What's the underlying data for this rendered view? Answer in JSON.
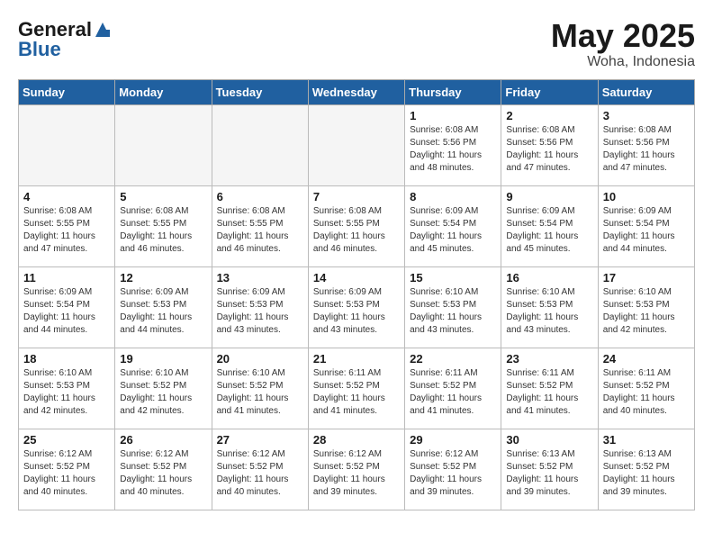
{
  "header": {
    "logo_text_general": "General",
    "logo_text_blue": "Blue",
    "title": "May 2025",
    "subtitle": "Woha, Indonesia"
  },
  "calendar": {
    "days_of_week": [
      "Sunday",
      "Monday",
      "Tuesday",
      "Wednesday",
      "Thursday",
      "Friday",
      "Saturday"
    ],
    "weeks": [
      [
        {
          "day": "",
          "info": ""
        },
        {
          "day": "",
          "info": ""
        },
        {
          "day": "",
          "info": ""
        },
        {
          "day": "",
          "info": ""
        },
        {
          "day": "1",
          "info": "Sunrise: 6:08 AM\nSunset: 5:56 PM\nDaylight: 11 hours\nand 48 minutes."
        },
        {
          "day": "2",
          "info": "Sunrise: 6:08 AM\nSunset: 5:56 PM\nDaylight: 11 hours\nand 47 minutes."
        },
        {
          "day": "3",
          "info": "Sunrise: 6:08 AM\nSunset: 5:56 PM\nDaylight: 11 hours\nand 47 minutes."
        }
      ],
      [
        {
          "day": "4",
          "info": "Sunrise: 6:08 AM\nSunset: 5:55 PM\nDaylight: 11 hours\nand 47 minutes."
        },
        {
          "day": "5",
          "info": "Sunrise: 6:08 AM\nSunset: 5:55 PM\nDaylight: 11 hours\nand 46 minutes."
        },
        {
          "day": "6",
          "info": "Sunrise: 6:08 AM\nSunset: 5:55 PM\nDaylight: 11 hours\nand 46 minutes."
        },
        {
          "day": "7",
          "info": "Sunrise: 6:08 AM\nSunset: 5:55 PM\nDaylight: 11 hours\nand 46 minutes."
        },
        {
          "day": "8",
          "info": "Sunrise: 6:09 AM\nSunset: 5:54 PM\nDaylight: 11 hours\nand 45 minutes."
        },
        {
          "day": "9",
          "info": "Sunrise: 6:09 AM\nSunset: 5:54 PM\nDaylight: 11 hours\nand 45 minutes."
        },
        {
          "day": "10",
          "info": "Sunrise: 6:09 AM\nSunset: 5:54 PM\nDaylight: 11 hours\nand 44 minutes."
        }
      ],
      [
        {
          "day": "11",
          "info": "Sunrise: 6:09 AM\nSunset: 5:54 PM\nDaylight: 11 hours\nand 44 minutes."
        },
        {
          "day": "12",
          "info": "Sunrise: 6:09 AM\nSunset: 5:53 PM\nDaylight: 11 hours\nand 44 minutes."
        },
        {
          "day": "13",
          "info": "Sunrise: 6:09 AM\nSunset: 5:53 PM\nDaylight: 11 hours\nand 43 minutes."
        },
        {
          "day": "14",
          "info": "Sunrise: 6:09 AM\nSunset: 5:53 PM\nDaylight: 11 hours\nand 43 minutes."
        },
        {
          "day": "15",
          "info": "Sunrise: 6:10 AM\nSunset: 5:53 PM\nDaylight: 11 hours\nand 43 minutes."
        },
        {
          "day": "16",
          "info": "Sunrise: 6:10 AM\nSunset: 5:53 PM\nDaylight: 11 hours\nand 43 minutes."
        },
        {
          "day": "17",
          "info": "Sunrise: 6:10 AM\nSunset: 5:53 PM\nDaylight: 11 hours\nand 42 minutes."
        }
      ],
      [
        {
          "day": "18",
          "info": "Sunrise: 6:10 AM\nSunset: 5:53 PM\nDaylight: 11 hours\nand 42 minutes."
        },
        {
          "day": "19",
          "info": "Sunrise: 6:10 AM\nSunset: 5:52 PM\nDaylight: 11 hours\nand 42 minutes."
        },
        {
          "day": "20",
          "info": "Sunrise: 6:10 AM\nSunset: 5:52 PM\nDaylight: 11 hours\nand 41 minutes."
        },
        {
          "day": "21",
          "info": "Sunrise: 6:11 AM\nSunset: 5:52 PM\nDaylight: 11 hours\nand 41 minutes."
        },
        {
          "day": "22",
          "info": "Sunrise: 6:11 AM\nSunset: 5:52 PM\nDaylight: 11 hours\nand 41 minutes."
        },
        {
          "day": "23",
          "info": "Sunrise: 6:11 AM\nSunset: 5:52 PM\nDaylight: 11 hours\nand 41 minutes."
        },
        {
          "day": "24",
          "info": "Sunrise: 6:11 AM\nSunset: 5:52 PM\nDaylight: 11 hours\nand 40 minutes."
        }
      ],
      [
        {
          "day": "25",
          "info": "Sunrise: 6:12 AM\nSunset: 5:52 PM\nDaylight: 11 hours\nand 40 minutes."
        },
        {
          "day": "26",
          "info": "Sunrise: 6:12 AM\nSunset: 5:52 PM\nDaylight: 11 hours\nand 40 minutes."
        },
        {
          "day": "27",
          "info": "Sunrise: 6:12 AM\nSunset: 5:52 PM\nDaylight: 11 hours\nand 40 minutes."
        },
        {
          "day": "28",
          "info": "Sunrise: 6:12 AM\nSunset: 5:52 PM\nDaylight: 11 hours\nand 39 minutes."
        },
        {
          "day": "29",
          "info": "Sunrise: 6:12 AM\nSunset: 5:52 PM\nDaylight: 11 hours\nand 39 minutes."
        },
        {
          "day": "30",
          "info": "Sunrise: 6:13 AM\nSunset: 5:52 PM\nDaylight: 11 hours\nand 39 minutes."
        },
        {
          "day": "31",
          "info": "Sunrise: 6:13 AM\nSunset: 5:52 PM\nDaylight: 11 hours\nand 39 minutes."
        }
      ]
    ]
  }
}
